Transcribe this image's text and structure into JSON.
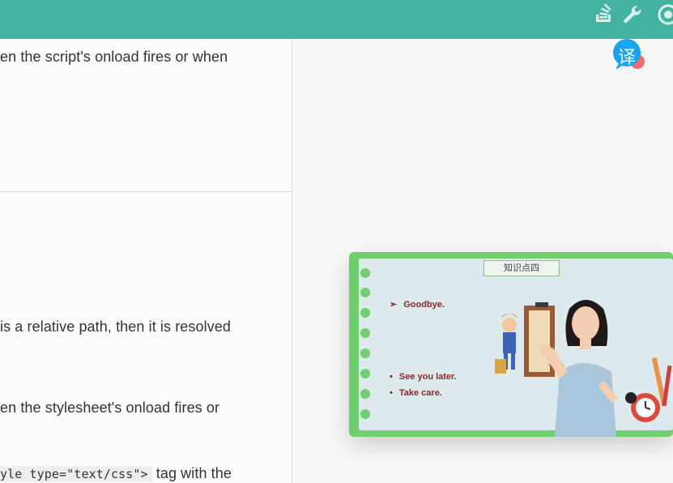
{
  "topbar": {
    "bg_color": "#43b3a0",
    "icons": [
      "stack-overflow-icon",
      "wrench-icon",
      "github-icon"
    ]
  },
  "doc": {
    "line1": "en the script's onload fires or when",
    "line2": " is a relative path, then it is resolved",
    "line3": "en the stylesheet's onload fires or",
    "line4_code": "yle type=\"text/css\">",
    "line4_text": " tag with the"
  },
  "translate_badge": {
    "glyph": "译",
    "icon": "translate-icon"
  },
  "video": {
    "tag": "知识点四",
    "goodbye": "Goodbye.",
    "see_you": "See you later.",
    "take_care": "Take care."
  }
}
